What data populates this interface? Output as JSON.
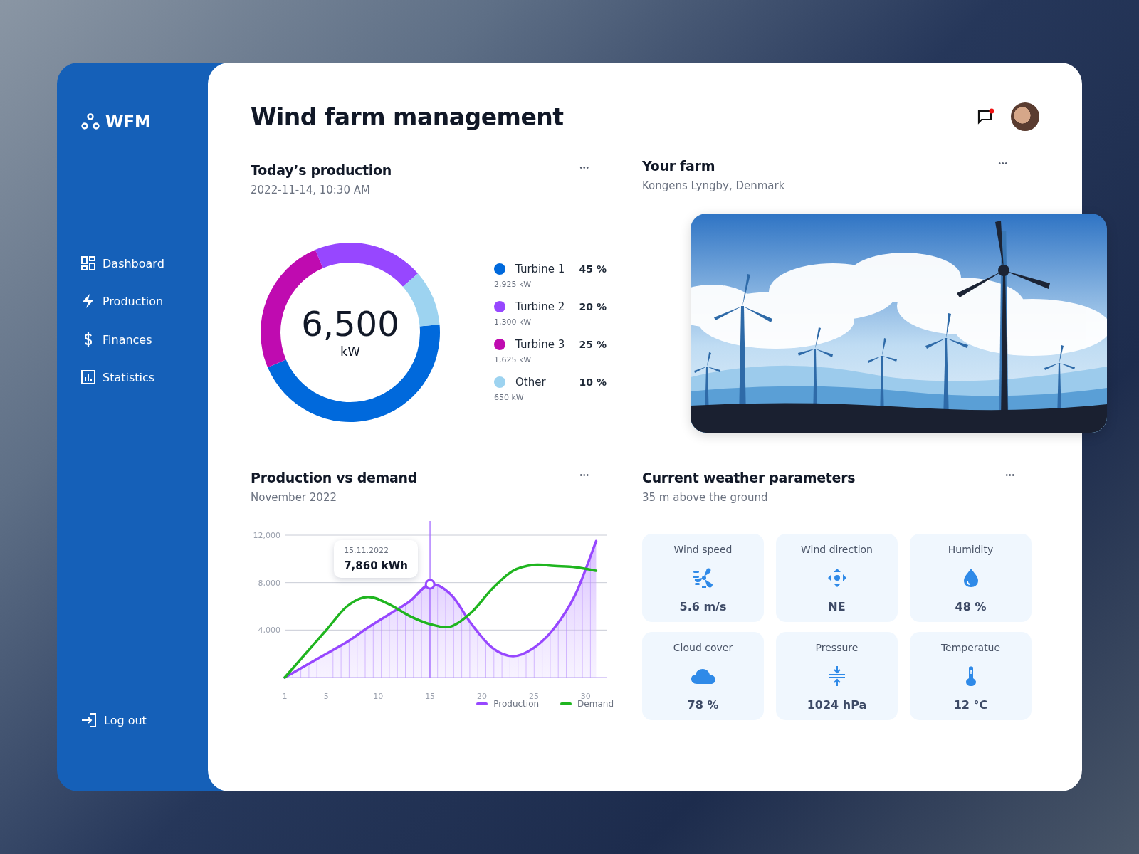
{
  "sidebar": {
    "logo": "WFM",
    "items": [
      {
        "kind": "dashboard",
        "label": "Dashboard"
      },
      {
        "kind": "production",
        "label": "Production"
      },
      {
        "kind": "finances",
        "label": "Finances"
      },
      {
        "kind": "statistics",
        "label": "Statistics"
      }
    ],
    "logout": "Log out"
  },
  "header": {
    "title": "Wind farm management",
    "has_notification": true
  },
  "production": {
    "title": "Today’s production",
    "subtitle": "2022-11-14, 10:30 AM",
    "menu": "•••",
    "total": "6,500",
    "unit": "kW",
    "chart_data": {
      "type": "donut",
      "categories": [
        "Turbine 1",
        "Turbine 2",
        "Turbine 3",
        "Other"
      ],
      "values": [
        45,
        20,
        25,
        10
      ]
    },
    "legend": [
      {
        "percent": "45 %",
        "amount": "2,925 kW",
        "color": "#0069dc"
      },
      {
        "percent": "20 %",
        "amount": "1,300 kW",
        "color": "#9747ff"
      },
      {
        "percent": "25 %",
        "amount": "1,625 kW",
        "color": "#bf0bb0"
      },
      {
        "percent": "10 %",
        "amount": "650 kW",
        "color": "#9dd3f0"
      }
    ]
  },
  "farm": {
    "title": "Your farm",
    "subtitle": "Kongens Lyngby, Denmark",
    "menu": "•••"
  },
  "demand": {
    "title": "Production vs demand",
    "subtitle": "November 2022",
    "menu": "•••",
    "tooltip": {
      "date": "15.11.2022",
      "value": "7,860 kWh"
    },
    "chart_data": {
      "type": "line",
      "x": [
        1,
        3,
        5,
        7,
        9,
        11,
        13,
        15,
        17,
        19,
        21,
        23,
        25,
        27,
        29,
        31
      ],
      "series": [
        {
          "name": "Production",
          "type": "area",
          "color": "#9747ff",
          "values": [
            0,
            1000,
            2000,
            3000,
            4200,
            5300,
            6400,
            7860,
            7000,
            4500,
            2500,
            1800,
            2500,
            4200,
            7000,
            11500
          ]
        },
        {
          "name": "Demand",
          "type": "line",
          "color": "#1fb51f",
          "values": [
            0,
            2000,
            4000,
            6000,
            6800,
            6200,
            5200,
            4500,
            4300,
            5500,
            7500,
            9000,
            9500,
            9400,
            9300,
            9000
          ]
        }
      ],
      "xlim": [
        1,
        32
      ],
      "ylim": [
        0,
        12000
      ],
      "grid": true,
      "legend": "lower right",
      "ref_lines": [
        {
          "axis": "x",
          "value": 15
        }
      ],
      "xticks": [
        1,
        5,
        10,
        15,
        20,
        25,
        30
      ],
      "yticks": [
        {
          "value": 4000,
          "label": "4,000"
        },
        {
          "value": 8000,
          "label": "8,000"
        },
        {
          "value": 12000,
          "label": "12,000"
        }
      ]
    }
  },
  "weather": {
    "title": "Current weather parameters",
    "subtitle": "35 m above the ground",
    "menu": "•••",
    "cards": [
      {
        "kind": "wind_speed",
        "label": "Wind speed",
        "value": "5.6 m/s"
      },
      {
        "kind": "wind_direction",
        "label": "Wind direction",
        "value": "NE"
      },
      {
        "kind": "humidity",
        "label": "Humidity",
        "value": "48 %"
      },
      {
        "kind": "cloud_cover",
        "label": "Cloud cover",
        "value": "78 %"
      },
      {
        "kind": "pressure",
        "label": "Pressure",
        "value": "1024 hPa"
      },
      {
        "kind": "temperature",
        "label": "Temperatue",
        "value": "12 °C"
      }
    ]
  }
}
